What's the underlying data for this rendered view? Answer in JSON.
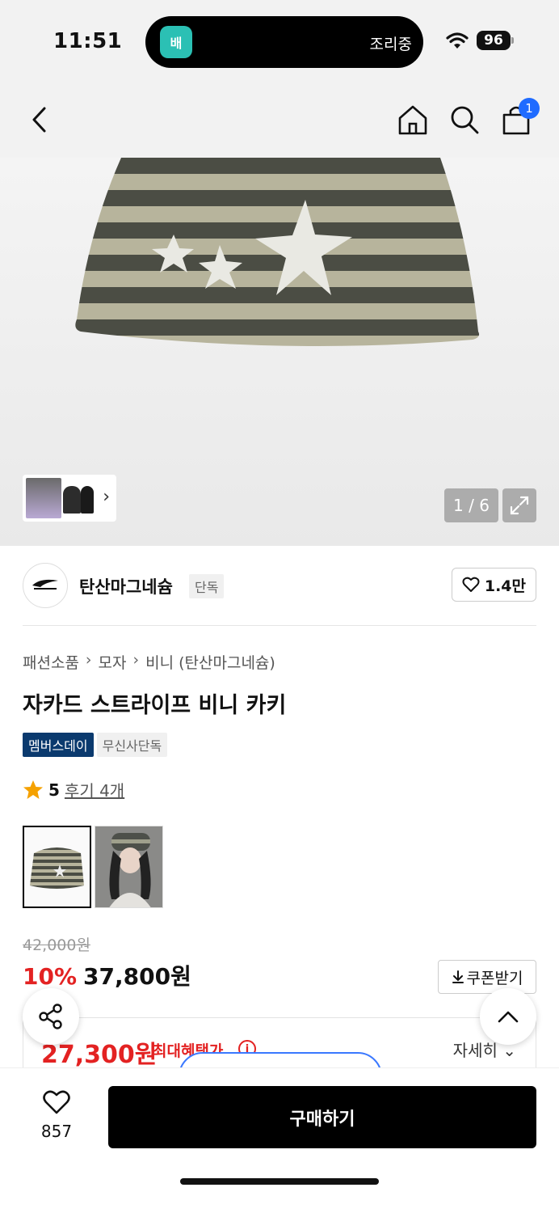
{
  "status_bar": {
    "time": "11:51",
    "island_app_text": "배",
    "island_status": "조리중",
    "battery": "96"
  },
  "nav": {
    "cart_count": "1"
  },
  "gallery": {
    "counter": "1 / 6"
  },
  "brand": {
    "name": "탄산마그네슘",
    "tag": "단독",
    "likes": "1.4만"
  },
  "breadcrumb": {
    "items": [
      "패션소품",
      "모자",
      "비니 (탄산마그네슘)"
    ]
  },
  "product": {
    "title": "자카드 스트라이프 비니 카키",
    "badges": [
      "멤버스데이",
      "무신사단독"
    ],
    "rating": "5",
    "reviews": "후기 4개"
  },
  "price": {
    "original": "42,000원",
    "discount": "10%",
    "sale": "37,800원",
    "coupon": "쿠폰받기",
    "best": "27,300원",
    "best_label": "최대혜택가",
    "detail": "자세히"
  },
  "bottom": {
    "wish_count": "857",
    "buy_label": "구매하기"
  },
  "colors": {
    "accent_red": "#e32222",
    "badge_navy": "#0b3a6e",
    "cart_badge": "#1f6bff"
  }
}
